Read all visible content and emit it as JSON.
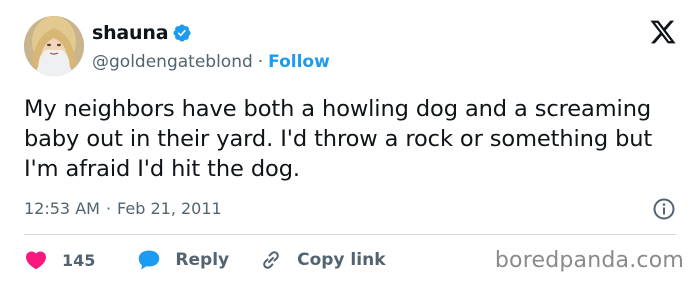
{
  "author": {
    "display_name": "shauna",
    "handle": "@goldengateblond",
    "separator": "·",
    "follow_label": "Follow"
  },
  "tweet": {
    "text": "My neighbors have both a howling dog and a screaming baby out in their yard. I'd throw a rock or something but I'm afraid I'd hit the dog.",
    "time": "12:53 AM",
    "separator": "·",
    "date": "Feb 21, 2011"
  },
  "actions": {
    "like_count": "145",
    "reply_label": "Reply",
    "copy_link_label": "Copy link"
  },
  "watermark": "boredpanda.com",
  "colors": {
    "accent": "#1d9bf0",
    "like": "#f91880",
    "text": "#0f1419",
    "muted": "#536471"
  },
  "icons": {
    "verified": "verified-badge-icon",
    "platform": "x-logo-icon",
    "info": "info-icon",
    "like": "heart-icon",
    "reply": "reply-bubble-icon",
    "copy_link": "link-icon"
  }
}
